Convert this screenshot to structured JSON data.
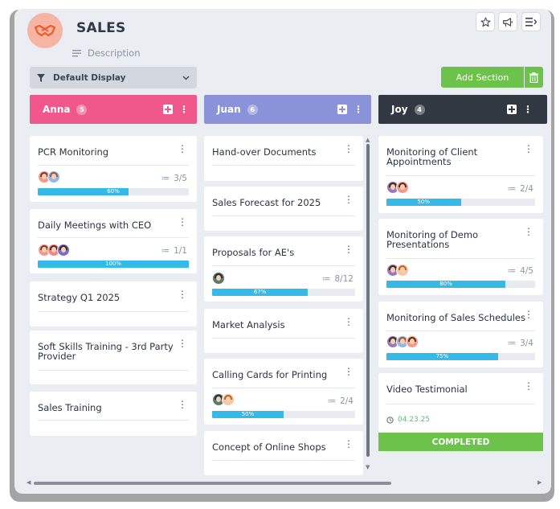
{
  "board": {
    "title": "SALES",
    "description": "Description"
  },
  "header_buttons": [
    "star-icon",
    "announcement-icon",
    "menu-icon"
  ],
  "toolbar": {
    "display_label": "Default Display",
    "add_section_label": "Add Section"
  },
  "colors": {
    "anna": "#f0578a",
    "juan": "#8b93d8",
    "joy": "#323842",
    "green": "#6cc24a",
    "progress": "#35b9e6"
  },
  "columns": [
    {
      "name": "Anna",
      "count": "5",
      "cards": [
        {
          "title": "PCR Monitoring",
          "checklist": "3/5",
          "progress_label": "60%",
          "progress": 0.6
        },
        {
          "title": "Daily Meetings with CEO",
          "checklist": "1/1",
          "progress_label": "100%",
          "progress": 1.0
        },
        {
          "title": "Strategy Q1 2025"
        },
        {
          "title": "Soft Skills Training - 3rd Party Provider"
        },
        {
          "title": "Sales Training"
        }
      ]
    },
    {
      "name": "Juan",
      "count": "6",
      "cards": [
        {
          "title": "Hand-over Documents"
        },
        {
          "title": "Sales Forecast for 2025"
        },
        {
          "title": "Proposals for AE's",
          "checklist": "8/12",
          "progress_label": "67%",
          "progress": 0.67
        },
        {
          "title": "Market Analysis"
        },
        {
          "title": "Calling Cards for Printing",
          "checklist": "2/4",
          "progress_label": "50%",
          "progress": 0.5
        },
        {
          "title": "Concept of Online Shops"
        }
      ]
    },
    {
      "name": "Joy",
      "count": "4",
      "cards": [
        {
          "title_line1": "Monitoring of Client",
          "title_line2": "Appointments",
          "checklist": "2/4",
          "progress_label": "50%",
          "progress": 0.5
        },
        {
          "title_line1": "Monitoring of Demo",
          "title_line2": "Presentations",
          "checklist": "4/5",
          "progress_label": "80%",
          "progress": 0.8
        },
        {
          "title": "Monitoring of Sales Schedules",
          "checklist": "3/4",
          "progress_label": "75%",
          "progress": 0.75
        },
        {
          "title": "Video Testimonial",
          "date": "04.23.25",
          "status": "COMPLETED"
        }
      ]
    }
  ]
}
